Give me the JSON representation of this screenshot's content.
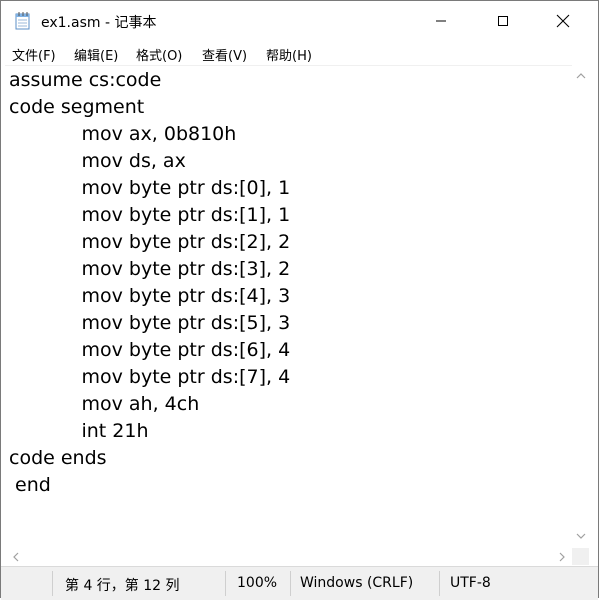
{
  "window": {
    "title": "ex1.asm - 记事本"
  },
  "menu": {
    "items": [
      "文件(F)",
      "编辑(E)",
      "格式(O)",
      "查看(V)",
      "帮助(H)"
    ]
  },
  "editor": {
    "lines": [
      "assume cs:code",
      "code segment",
      "            mov ax, 0b810h",
      "            mov ds, ax",
      "            mov byte ptr ds:[0], 1",
      "            mov byte ptr ds:[1], 1",
      "            mov byte ptr ds:[2], 2",
      "            mov byte ptr ds:[3], 2",
      "            mov byte ptr ds:[4], 3",
      "            mov byte ptr ds:[5], 3",
      "            mov byte ptr ds:[6], 4",
      "            mov byte ptr ds:[7], 4",
      "            mov ah, 4ch",
      "            int 21h",
      "code ends",
      " end"
    ]
  },
  "status": {
    "position": "第 4 行，第 12 列",
    "zoom": "100%",
    "line_ending": "Windows (CRLF)",
    "encoding": "UTF-8"
  },
  "icons": {
    "app": "notepad-icon",
    "minimize": "minimize-icon",
    "maximize": "maximize-icon",
    "close": "close-icon"
  }
}
